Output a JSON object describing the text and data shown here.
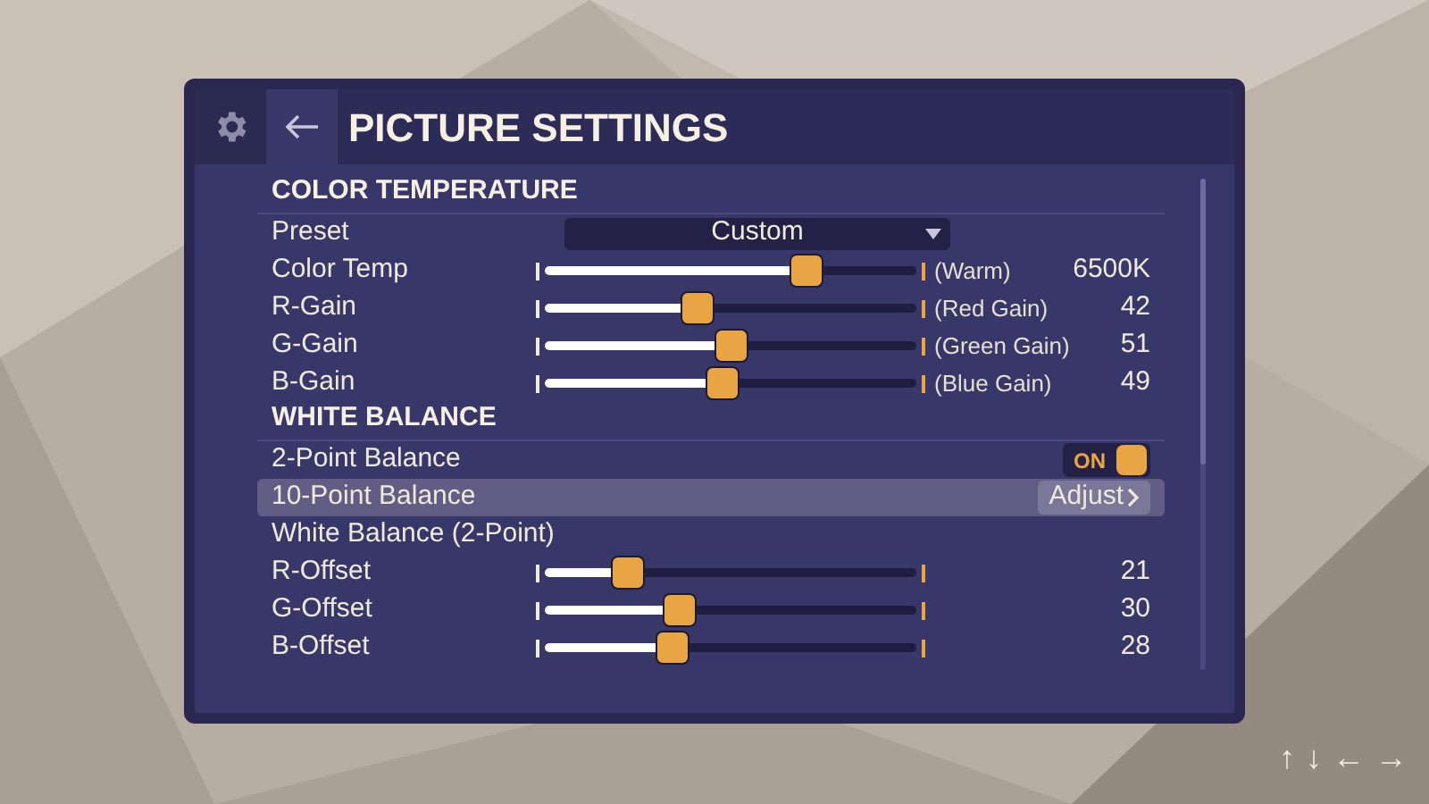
{
  "header": {
    "title": "PICTURE SETTINGS"
  },
  "sections": [
    {
      "title": "COLOR TEMPERATURE",
      "rows": [
        {
          "kind": "dropdown",
          "label": "Preset",
          "value": "Custom",
          "selected": false
        },
        {
          "kind": "slider",
          "label": "Color Temp",
          "level": 0.7,
          "note": "(Warm)",
          "reading": "6500K",
          "selected": false
        },
        {
          "kind": "slider",
          "label": "R-Gain",
          "level": 0.41,
          "note": "(Red Gain)",
          "reading": "42",
          "selected": false
        },
        {
          "kind": "slider",
          "label": "G-Gain",
          "level": 0.5,
          "note": "(Green Gain)",
          "reading": "51",
          "selected": false
        },
        {
          "kind": "slider",
          "label": "B-Gain",
          "level": 0.475,
          "note": "(Blue Gain)",
          "reading": "49",
          "selected": false
        }
      ]
    },
    {
      "title": "WHITE BALANCE",
      "rows": [
        {
          "kind": "toggle",
          "label": "2-Point Balance",
          "on": true,
          "state_text": "ON",
          "selected": false
        },
        {
          "kind": "link",
          "label": "10-Point Balance",
          "action": "Adjust",
          "selected": true
        },
        {
          "kind": "label",
          "label": "White Balance (2-Point)",
          "selected": false
        },
        {
          "kind": "slider",
          "label": "R-Offset",
          "level": 0.22,
          "reading": "21",
          "selected": false
        },
        {
          "kind": "slider",
          "label": "G-Offset",
          "level": 0.36,
          "reading": "30",
          "selected": false
        },
        {
          "kind": "slider",
          "label": "B-Offset",
          "level": 0.34,
          "reading": "28",
          "selected": false
        }
      ]
    }
  ],
  "nav_hints": [
    "↑",
    "↓",
    "←",
    "→"
  ]
}
